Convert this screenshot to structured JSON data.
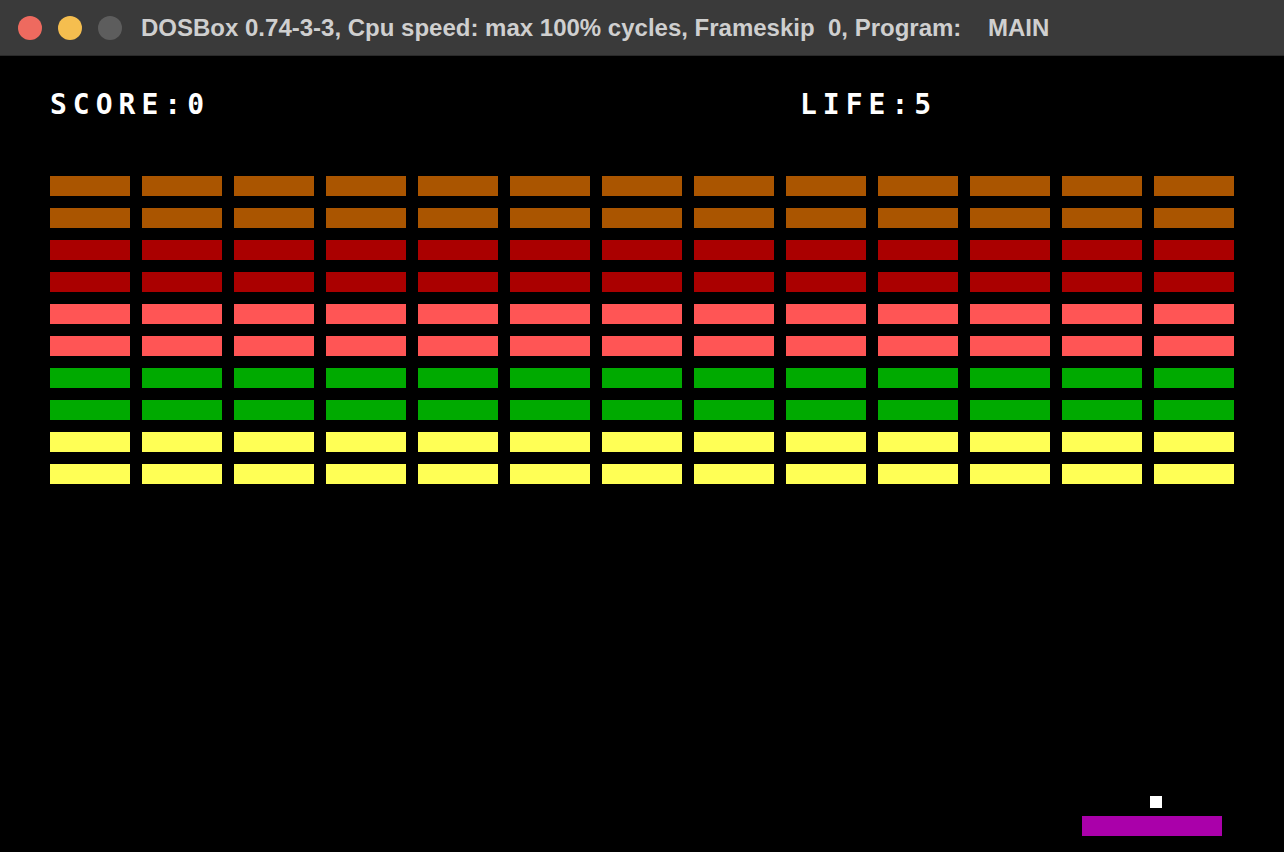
{
  "window": {
    "title": "DOSBox 0.74-3-3, Cpu speed: max 100% cycles, Frameskip  0, Program:    MAIN"
  },
  "hud": {
    "score_label": "SCORE:",
    "score": "0",
    "life_label": "LIFE:",
    "life": "5"
  },
  "brick_rows": [
    {
      "color": "#aa5500",
      "intact": [
        true,
        true,
        true,
        true,
        true,
        true,
        true,
        true,
        true,
        true,
        true,
        true,
        true
      ]
    },
    {
      "color": "#aa5500",
      "intact": [
        true,
        true,
        true,
        true,
        true,
        true,
        true,
        true,
        true,
        true,
        true,
        true,
        true
      ]
    },
    {
      "color": "#aa0000",
      "intact": [
        true,
        true,
        true,
        true,
        true,
        true,
        true,
        true,
        true,
        true,
        true,
        true,
        true
      ]
    },
    {
      "color": "#aa0000",
      "intact": [
        true,
        true,
        true,
        true,
        true,
        true,
        true,
        true,
        true,
        true,
        true,
        true,
        true
      ]
    },
    {
      "color": "#ff5555",
      "intact": [
        true,
        true,
        true,
        true,
        true,
        true,
        true,
        true,
        true,
        true,
        true,
        true,
        true
      ]
    },
    {
      "color": "#ff5555",
      "intact": [
        true,
        true,
        true,
        true,
        true,
        true,
        true,
        true,
        true,
        true,
        true,
        true,
        true
      ]
    },
    {
      "color": "#00aa00",
      "intact": [
        true,
        true,
        true,
        true,
        true,
        true,
        true,
        true,
        true,
        true,
        true,
        true,
        true
      ]
    },
    {
      "color": "#00aa00",
      "intact": [
        true,
        true,
        true,
        true,
        true,
        true,
        true,
        true,
        true,
        true,
        true,
        true,
        true
      ]
    },
    {
      "color": "#ffff55",
      "intact": [
        true,
        true,
        true,
        true,
        true,
        true,
        true,
        true,
        true,
        true,
        true,
        true,
        true
      ]
    },
    {
      "color": "#ffff55",
      "intact": [
        true,
        true,
        true,
        true,
        true,
        true,
        true,
        true,
        true,
        true,
        true,
        true,
        true
      ]
    }
  ]
}
